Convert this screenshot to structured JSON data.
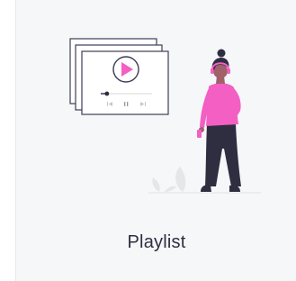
{
  "card": {
    "label": "Playlist",
    "illustration": "playlist-illustration",
    "icons": [
      "play-icon",
      "previous-icon",
      "pause-icon",
      "next-icon"
    ]
  },
  "colors": {
    "accent": "#f35fc3",
    "dark": "#2f2e41",
    "card_background": "#f6f7f9",
    "frame_stroke": "#3f3d56",
    "light_gray": "#e6e6e6"
  },
  "player": {
    "progress": 0.12
  }
}
